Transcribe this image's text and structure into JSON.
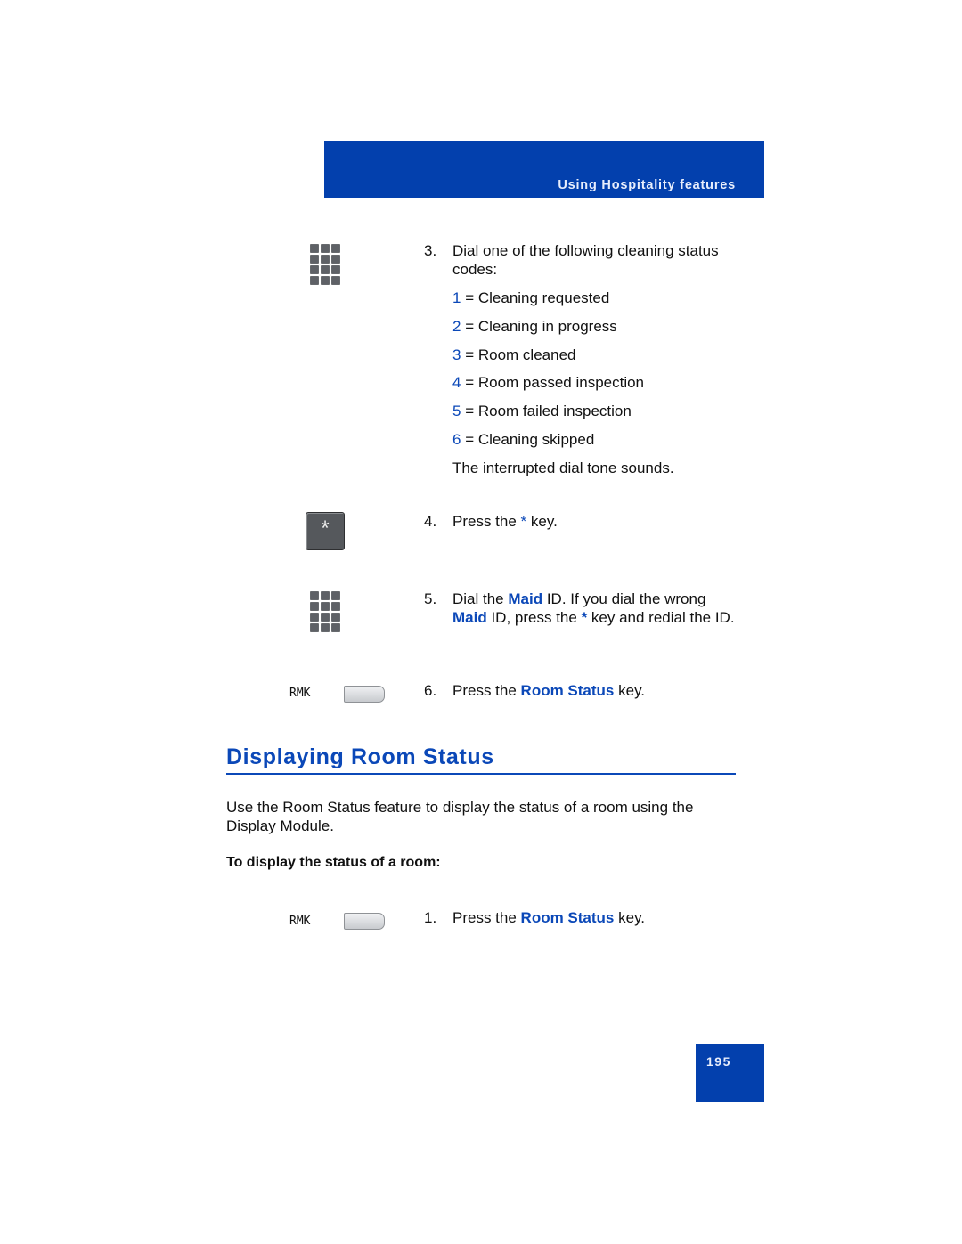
{
  "header": {
    "section_title": "Using Hospitality features"
  },
  "steps_top": [
    {
      "number": "3.",
      "text": "Dial one of the following cleaning status codes:"
    },
    {
      "number": "4.",
      "text_before": "Press the ",
      "key": "*",
      "text_after": " key."
    },
    {
      "number": "5.",
      "text_parts": [
        "Dial the ",
        "Maid",
        " ID. If you dial the wrong ",
        "Maid",
        " ID, press the ",
        "*",
        " key and redial the ID."
      ]
    },
    {
      "number": "6.",
      "text_before": "Press the ",
      "key": "Room Status",
      "text_after": " key."
    }
  ],
  "codes": [
    {
      "code": "1",
      "label": "= Cleaning requested"
    },
    {
      "code": "2",
      "label": "= Cleaning in progress"
    },
    {
      "code": "3",
      "label": "= Room cleaned"
    },
    {
      "code": "4",
      "label": "= Room passed inspection"
    },
    {
      "code": "5",
      "label": "= Room failed inspection"
    },
    {
      "code": "6",
      "label": "= Cleaning skipped"
    }
  ],
  "after_codes": "The interrupted dial tone sounds.",
  "icons": {
    "star_key": "*",
    "rmk_label": "RMK"
  },
  "section": {
    "title": "Displaying Room Status",
    "paragraph": "Use the Room Status feature to display the status of a room using the Display Module.",
    "subheading": "To display the status of a room:",
    "step1": {
      "number": "1.",
      "text_before": "Press the ",
      "key": "Room Status",
      "text_after": " key."
    }
  },
  "page_number": "195",
  "colors": {
    "brand_blue": "#0340ad",
    "link_blue": "#0b48b8"
  }
}
